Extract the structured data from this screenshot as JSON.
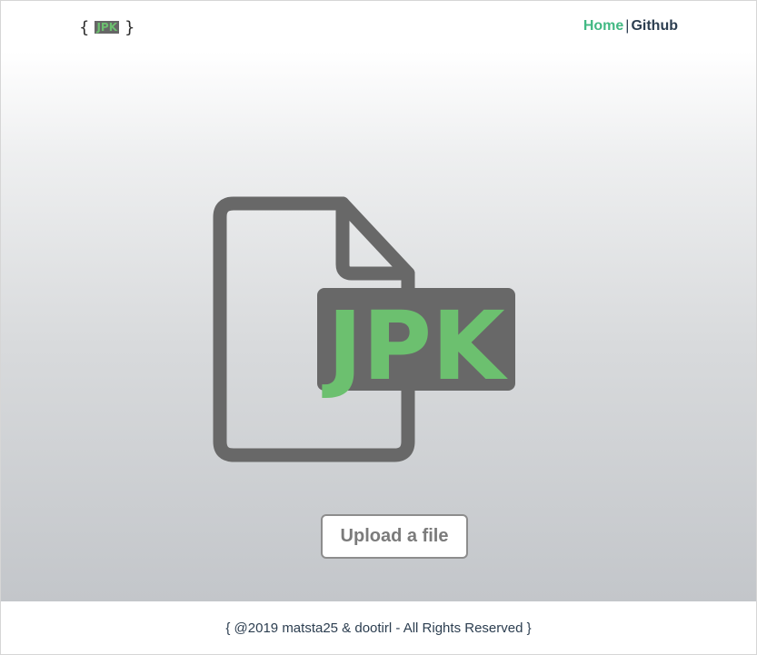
{
  "header": {
    "logo": {
      "open_brace": "{",
      "badge_text": "JPK",
      "close_brace": "}"
    },
    "nav": {
      "home_label": "Home",
      "separator": "|",
      "github_label": "Github"
    }
  },
  "main": {
    "file_icon": {
      "icon": "file-icon",
      "label": "JPK",
      "icon_color": "#686868",
      "label_color": "#6cc06f"
    },
    "upload_button_label": "Upload a file"
  },
  "footer": {
    "text": "{ @2019 matsta25 & dootirl - All Rights Reserved }"
  },
  "colors": {
    "accent": "#42b983",
    "text": "#2c3e50"
  }
}
